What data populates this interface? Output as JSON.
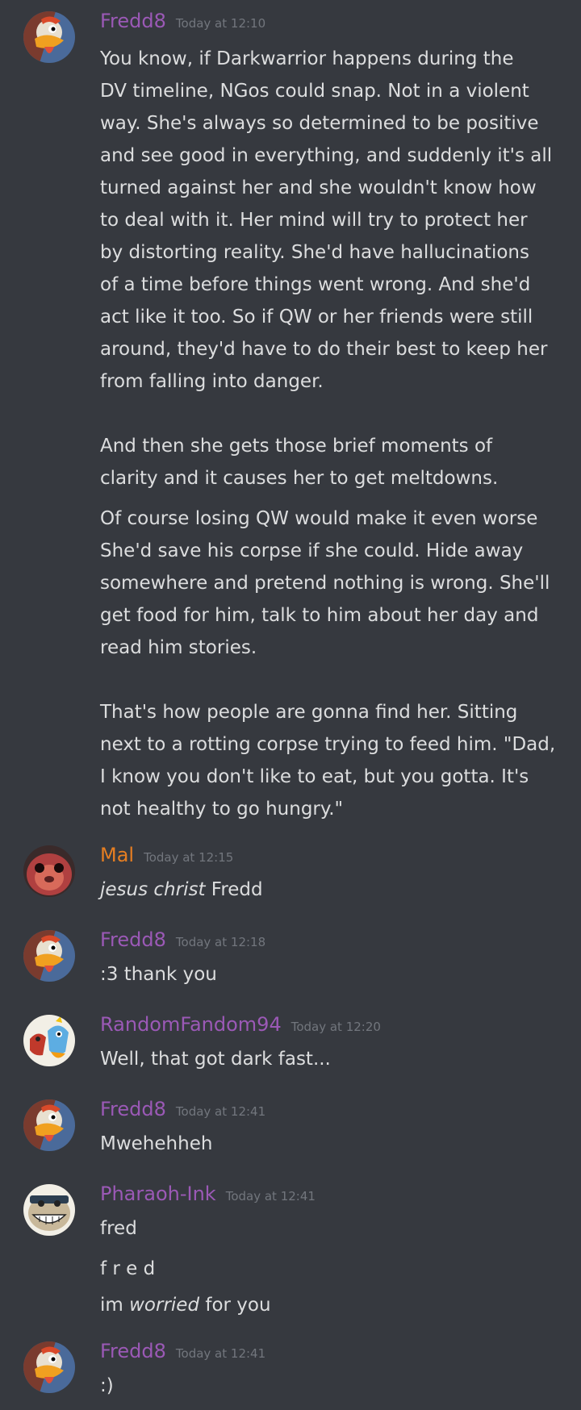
{
  "colors": {
    "background": "#36393f",
    "text": "#dcddde",
    "timestamp": "#72767d",
    "fredd8": "#9b59b6",
    "mal": "#e67e22",
    "randomfandom94": "#9b59b6",
    "pharaoh_ink": "#9b59b6"
  },
  "messages": [
    {
      "author": "Fredd8",
      "avatar_icon": "duck-avatar-icon",
      "time": "Today at 12:10",
      "lines": [
        "You know, if Darkwarrior happens during the",
        "DV timeline, NGos could snap. Not in a violent",
        "way. She's always so determined to be positive",
        "and see good in everything, and suddenly it's all",
        "turned against her and she wouldn't know how",
        "to deal with it. Her mind will try to protect her",
        "by distorting reality. She'd have hallucinations",
        "of a time before things went wrong. And she'd",
        "act like it too. So if QW or her friends were still",
        "around, they'd have to do their best to keep her",
        "from falling into danger.",
        "And then she gets those brief moments of",
        "clarity and it causes her to get meltdowns.",
        "Of course losing QW would make it even worse",
        "She'd save his corpse if she could. Hide away",
        "somewhere and pretend nothing is wrong. She'll",
        "get food for him, talk to him about her day and",
        "read him stories.",
        "That's how people are gonna find her. Sitting",
        "next to a rotting corpse trying to feed him. \"Dad,",
        "I know you don't like to eat, but you gotta. It's",
        "not healthy to go hungry.\""
      ]
    },
    {
      "author": "Mal",
      "avatar_icon": "porg-avatar-icon",
      "time": "Today at 12:15",
      "line_italic": "jesus christ",
      "line_rest": " Fredd"
    },
    {
      "author": "Fredd8",
      "avatar_icon": "duck-avatar-icon",
      "time": "Today at 12:18",
      "lines": [
        ":3 thank you"
      ]
    },
    {
      "author": "RandomFandom94",
      "avatar_icon": "cartoon-characters-avatar-icon",
      "time": "Today at 12:20",
      "lines": [
        "Well, that got dark fast..."
      ]
    },
    {
      "author": "Fredd8",
      "avatar_icon": "duck-avatar-icon",
      "time": "Today at 12:41",
      "lines": [
        "Mwehehheh"
      ]
    },
    {
      "author": "Pharaoh-Ink",
      "avatar_icon": "grinning-character-avatar-icon",
      "time": "Today at 12:41",
      "lines": [
        "fred",
        "f r e d"
      ],
      "line_pre": "im ",
      "line_italic": "worried",
      "line_post": " for you"
    },
    {
      "author": "Fredd8",
      "avatar_icon": "duck-avatar-icon",
      "time": "Today at 12:41",
      "lines": [
        ":)"
      ]
    }
  ]
}
